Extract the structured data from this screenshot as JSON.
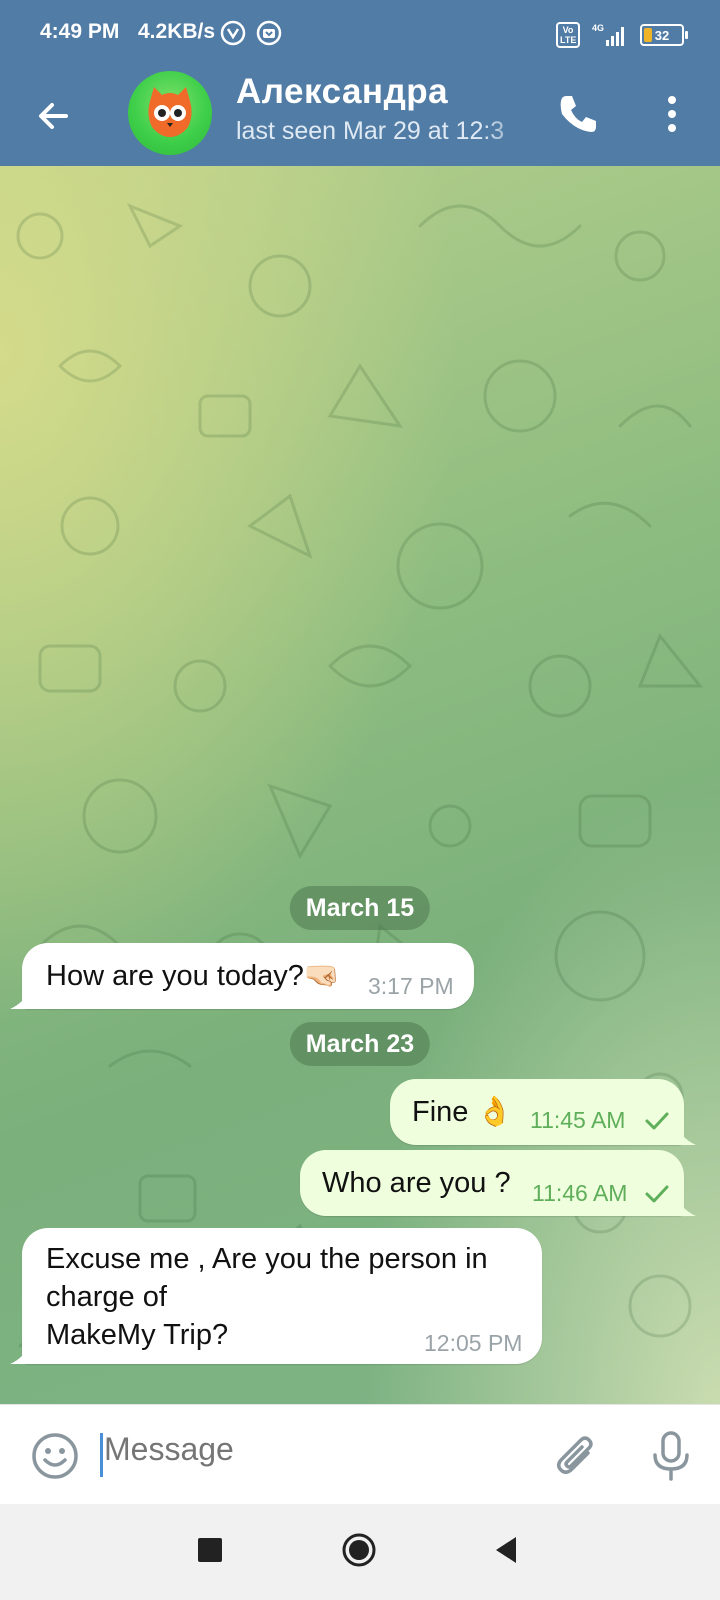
{
  "status_bar": {
    "time": "4:49 PM",
    "speed": "4.2KB/s",
    "network": "4G",
    "volte": "Vo LTE",
    "battery": "32"
  },
  "header": {
    "contact_name": "Александра",
    "last_seen": "last seen Mar 29 at 12:3"
  },
  "messages": [
    {
      "type": "date",
      "text": "March 15"
    },
    {
      "type": "incoming",
      "text": "How are you today?🤜🏻",
      "time": "3:17 PM"
    },
    {
      "type": "date",
      "text": "March 23"
    },
    {
      "type": "outgoing",
      "text": "Fine 👌",
      "time": "11:45 AM"
    },
    {
      "type": "outgoing",
      "text": "Who are you ?",
      "time": "11:46 AM"
    },
    {
      "type": "incoming",
      "lines": [
        "Excuse me , Are you the person in",
        "charge of",
        "MakeMy Trip?"
      ],
      "time": "12:05 PM"
    }
  ],
  "composer": {
    "placeholder": "Message"
  },
  "colors": {
    "header_bg": "#517ca5",
    "outgoing_bubble": "#efffde",
    "time_out": "#5fae5a"
  }
}
